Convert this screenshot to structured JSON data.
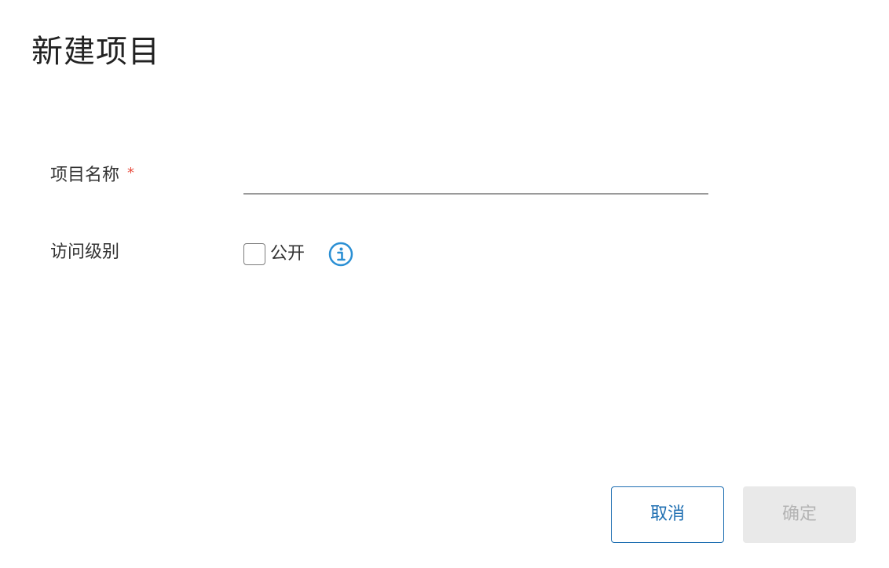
{
  "dialog": {
    "title": "新建项目"
  },
  "form": {
    "project_name": {
      "label": "项目名称",
      "required_mark": "*",
      "value": "",
      "placeholder": ""
    },
    "access_level": {
      "label": "访问级别",
      "checkbox_label": "公开",
      "checked": false,
      "info_icon": "info-circle-icon"
    }
  },
  "buttons": {
    "cancel_label": "取消",
    "confirm_label": "确定",
    "confirm_disabled": true
  },
  "colors": {
    "accent": "#1f6fb2",
    "info_icon": "#2a8fd4",
    "required": "#e84c3d",
    "disabled_bg": "#e9e9e9",
    "disabled_text": "#b4b4b4"
  }
}
